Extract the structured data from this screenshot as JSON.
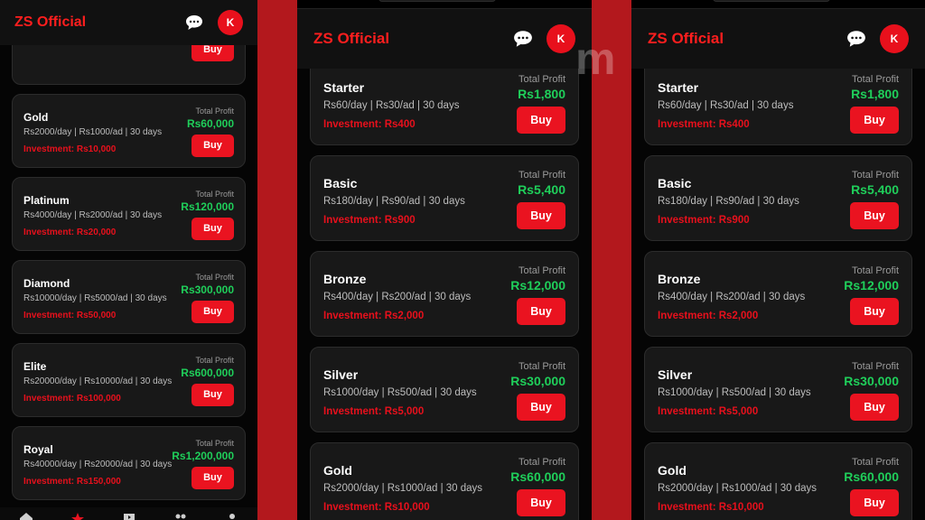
{
  "app": {
    "title": "ZS Official",
    "avatar_letter": "K"
  },
  "buy_label": "Buy",
  "profit_label": "Total Profit",
  "watermark": "m",
  "panel1_plans": [
    {
      "name": "",
      "rate": "",
      "investment": "Investment: Rs5,000",
      "profit": ""
    },
    {
      "name": "Gold",
      "rate": "Rs2000/day | Rs1000/ad | 30 days",
      "investment": "Investment: Rs10,000",
      "profit": "Rs60,000"
    },
    {
      "name": "Platinum",
      "rate": "Rs4000/day | Rs2000/ad | 30 days",
      "investment": "Investment: Rs20,000",
      "profit": "Rs120,000"
    },
    {
      "name": "Diamond",
      "rate": "Rs10000/day | Rs5000/ad | 30 days",
      "investment": "Investment: Rs50,000",
      "profit": "Rs300,000"
    },
    {
      "name": "Elite",
      "rate": "Rs20000/day | Rs10000/ad | 30 days",
      "investment": "Investment: Rs100,000",
      "profit": "Rs600,000"
    },
    {
      "name": "Royal",
      "rate": "Rs40000/day | Rs20000/ad | 30 days",
      "investment": "Investment: Rs150,000",
      "profit": "Rs1,200,000"
    }
  ],
  "plans": [
    {
      "name": "Starter",
      "rate": "Rs60/day | Rs30/ad | 30 days",
      "investment": "Investment: Rs400",
      "profit": "Rs1,800"
    },
    {
      "name": "Basic",
      "rate": "Rs180/day | Rs90/ad | 30 days",
      "investment": "Investment: Rs900",
      "profit": "Rs5,400"
    },
    {
      "name": "Bronze",
      "rate": "Rs400/day | Rs200/ad | 30 days",
      "investment": "Investment: Rs2,000",
      "profit": "Rs12,000"
    },
    {
      "name": "Silver",
      "rate": "Rs1000/day | Rs500/ad | 30 days",
      "investment": "Investment: Rs5,000",
      "profit": "Rs30,000"
    },
    {
      "name": "Gold",
      "rate": "Rs2000/day | Rs1000/ad | 30 days",
      "investment": "Investment: Rs10,000",
      "profit": "Rs60,000"
    }
  ],
  "nav": [
    "home-icon",
    "star-icon",
    "video-icon",
    "team-icon",
    "profile-icon"
  ],
  "colors": {
    "accent": "#ea1320",
    "profit": "#1fcf5a",
    "background": "#050505",
    "card": "#181818"
  }
}
